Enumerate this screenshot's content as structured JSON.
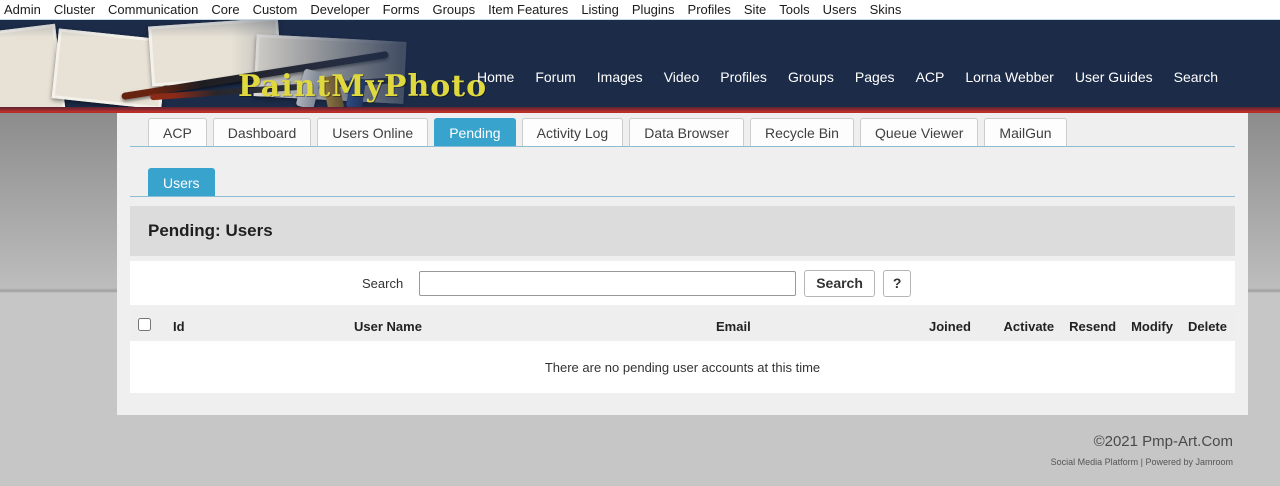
{
  "colors": {
    "header_navy": "#1b2b48",
    "accent_blue": "#38a3cd",
    "red_rule": "#c03028",
    "logo_gold": "#e0d83f"
  },
  "admin_bar": {
    "items": [
      "Admin",
      "Cluster",
      "Communication",
      "Core",
      "Custom",
      "Developer",
      "Forms",
      "Groups",
      "Item Features",
      "Listing",
      "Plugins",
      "Profiles",
      "Site",
      "Tools",
      "Users",
      "Skins"
    ]
  },
  "header": {
    "logo": "PaintMyPhoto",
    "nav": [
      "Home",
      "Forum",
      "Images",
      "Video",
      "Profiles",
      "Groups",
      "Pages",
      "ACP",
      "Lorna Webber",
      "User Guides",
      "Search"
    ]
  },
  "tabs": {
    "items": [
      {
        "label": "ACP",
        "active": false
      },
      {
        "label": "Dashboard",
        "active": false
      },
      {
        "label": "Users Online",
        "active": false
      },
      {
        "label": "Pending",
        "active": true
      },
      {
        "label": "Activity Log",
        "active": false
      },
      {
        "label": "Data Browser",
        "active": false
      },
      {
        "label": "Recycle Bin",
        "active": false
      },
      {
        "label": "Queue Viewer",
        "active": false
      },
      {
        "label": "MailGun",
        "active": false
      }
    ]
  },
  "subtabs": {
    "items": [
      {
        "label": "Users",
        "active": true
      }
    ]
  },
  "panel": {
    "title": "Pending: Users"
  },
  "search": {
    "label": "Search",
    "value": "",
    "button_label": "Search",
    "help_label": "?"
  },
  "table": {
    "columns": [
      "Id",
      "User Name",
      "Email",
      "Joined",
      "Activate",
      "Resend",
      "Modify",
      "Delete"
    ],
    "empty_message": "There are no pending user accounts at this time"
  },
  "footer": {
    "copyright": "©2021 Pmp-Art.Com",
    "tagline": "Social Media Platform | Powered by Jamroom"
  }
}
